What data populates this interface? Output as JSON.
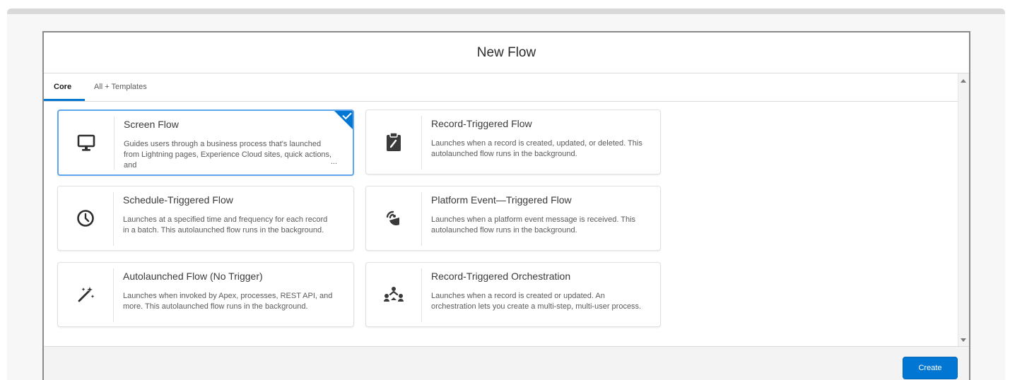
{
  "modal": {
    "title": "New Flow"
  },
  "tabs": [
    {
      "label": "Core",
      "active": true
    },
    {
      "label": "All + Templates",
      "active": false
    }
  ],
  "cards": [
    {
      "title": "Screen Flow",
      "description": "Guides users through a business process that's launched from Lightning pages, Experience Cloud sites, quick actions, and",
      "more": "...",
      "icon": "desktop-icon",
      "selected": true
    },
    {
      "title": "Record-Triggered Flow",
      "description": "Launches when a record is created, updated, or deleted. This autolaunched flow runs in the background.",
      "icon": "clipboard-icon",
      "selected": false
    },
    {
      "title": "Schedule-Triggered Flow",
      "description": "Launches at a specified time and frequency for each record in a batch. This autolaunched flow runs in the background.",
      "icon": "clock-icon",
      "selected": false
    },
    {
      "title": "Platform Event—Triggered Flow",
      "description": "Launches when a platform event message is received. This autolaunched flow runs in the background.",
      "icon": "broadcast-icon",
      "selected": false
    },
    {
      "title": "Autolaunched Flow (No Trigger)",
      "description": "Launches when invoked by Apex, processes, REST API, and more. This autolaunched flow runs in the background.",
      "icon": "magic-wand-icon",
      "selected": false
    },
    {
      "title": "Record-Triggered Orchestration",
      "description": "Launches when a record is created or updated. An orchestration lets you create a multi-step, multi-user process.",
      "icon": "orchestration-icon",
      "selected": false
    }
  ],
  "footer": {
    "create_label": "Create"
  },
  "colors": {
    "brand": "#0176d3",
    "selected_border": "#5ea7ee"
  }
}
